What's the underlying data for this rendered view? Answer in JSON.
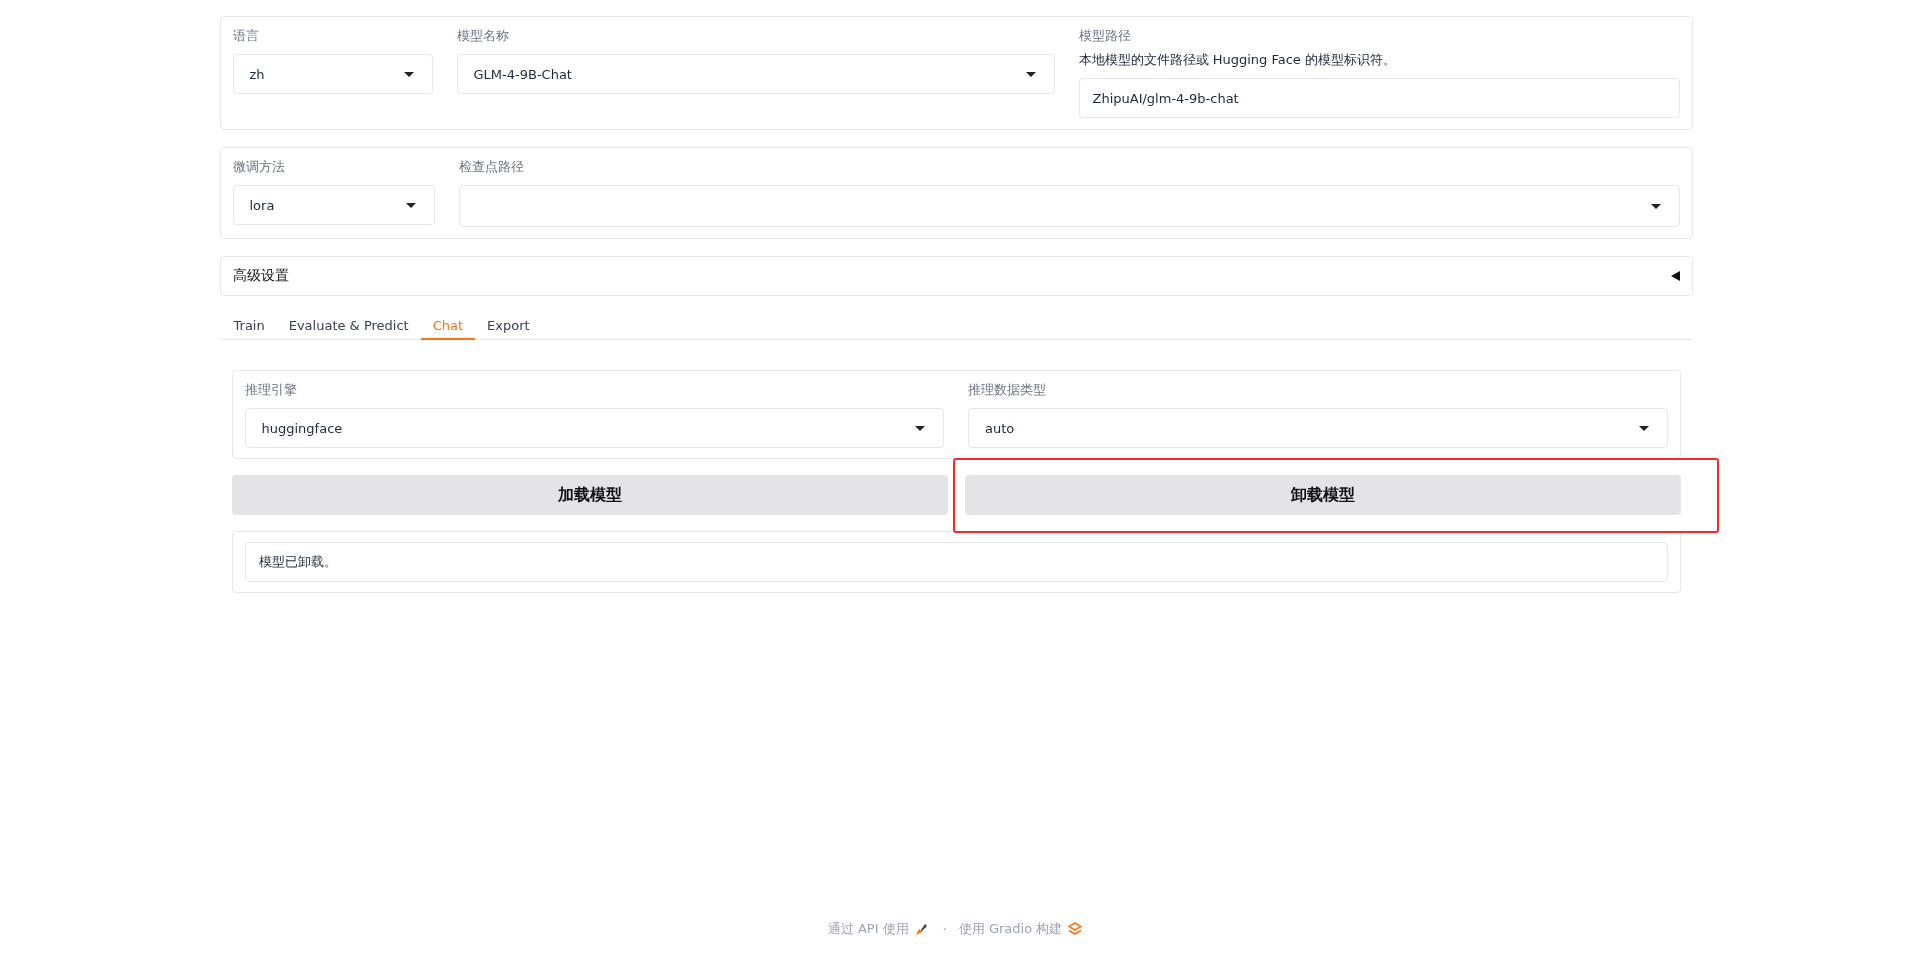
{
  "top_settings": {
    "language": {
      "label": "语言",
      "value": "zh"
    },
    "model_name": {
      "label": "模型名称",
      "value": "GLM-4-9B-Chat"
    },
    "model_path": {
      "label": "模型路径",
      "info": "本地模型的文件路径或 Hugging Face 的模型标识符。",
      "value": "ZhipuAI/glm-4-9b-chat"
    }
  },
  "adapter": {
    "finetuning_method": {
      "label": "微调方法",
      "value": "lora"
    },
    "checkpoint_path": {
      "label": "检查点路径"
    }
  },
  "advanced": {
    "label": "高级设置",
    "expanded": false
  },
  "tabs": [
    {
      "label": "Train",
      "selected": false
    },
    {
      "label": "Evaluate & Predict",
      "selected": false
    },
    {
      "label": "Chat",
      "selected": true
    },
    {
      "label": "Export",
      "selected": false
    }
  ],
  "chat": {
    "infer_backend": {
      "label": "推理引擎",
      "value": "huggingface"
    },
    "infer_dtype": {
      "label": "推理数据类型",
      "value": "auto"
    },
    "buttons": [
      {
        "label": "加载模型",
        "highlighted": false
      },
      {
        "label": "卸载模型",
        "highlighted": true
      }
    ],
    "info_box": {
      "value": "模型已卸载。"
    }
  },
  "footer": {
    "api_link": "通过 API 使用",
    "separator": "·",
    "built_with": "使用 Gradio 构建"
  }
}
